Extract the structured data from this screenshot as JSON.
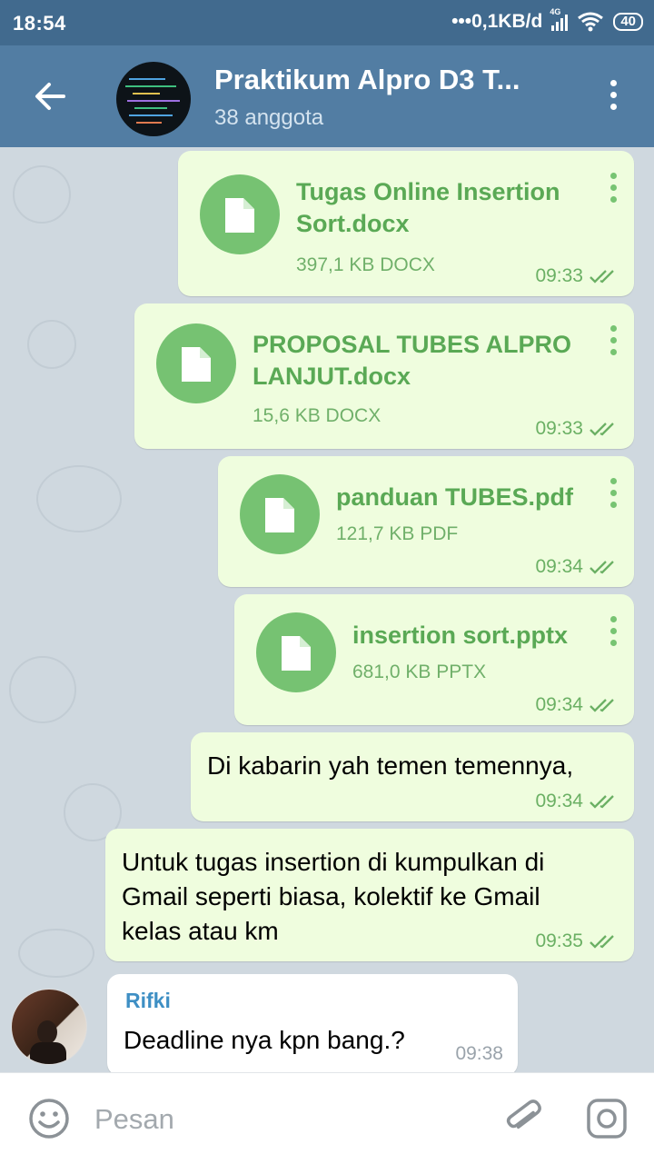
{
  "status_bar": {
    "time": "18:54",
    "network": "•••0,1KB/d",
    "signal_label": "4G",
    "battery": "40"
  },
  "header": {
    "title": "Praktikum Alpro D3 T...",
    "subtitle": "38 anggota",
    "icons": [
      "back-arrow-icon",
      "group-avatar",
      "more-vert-icon"
    ]
  },
  "messages": [
    {
      "type": "file",
      "name_line1": "Tugas Online Insertion",
      "name_line2": "Sort.docx",
      "size": "397,1 KB DOCX",
      "time": "09:33",
      "status": "read"
    },
    {
      "type": "file",
      "name_line1": "PROPOSAL TUBES ALPRO",
      "name_line2": "LANJUT.docx",
      "size": "15,6 KB DOCX",
      "time": "09:33",
      "status": "read"
    },
    {
      "type": "file",
      "name_line1": "panduan TUBES.pdf",
      "size": "121,7 KB PDF",
      "time": "09:34",
      "status": "read"
    },
    {
      "type": "file",
      "name_line1": "insertion sort.pptx",
      "size": "681,0 KB PPTX",
      "time": "09:34",
      "status": "read"
    },
    {
      "type": "text",
      "lines": [
        "Di kabarin yah temen temennya,"
      ],
      "time": "09:34",
      "status": "read"
    },
    {
      "type": "text",
      "lines": [
        "Untuk tugas insertion di kumpulkan di",
        "Gmail seperti biasa, kolektif ke Gmail",
        "kelas atau km"
      ],
      "time": "09:35",
      "status": "read"
    },
    {
      "type": "incoming",
      "sender": "Rifki",
      "text": "Deadline nya kpn bang.?",
      "time": "09:38"
    }
  ],
  "input": {
    "placeholder": "Pesan",
    "icons": [
      "emoji-icon",
      "attach-icon",
      "camera-icon"
    ]
  },
  "colors": {
    "header": "#527da3",
    "statusbar": "#416a8e",
    "outgoing_bubble": "#effdde",
    "file_accent": "#76c272",
    "link_name": "#3e8fc4"
  }
}
